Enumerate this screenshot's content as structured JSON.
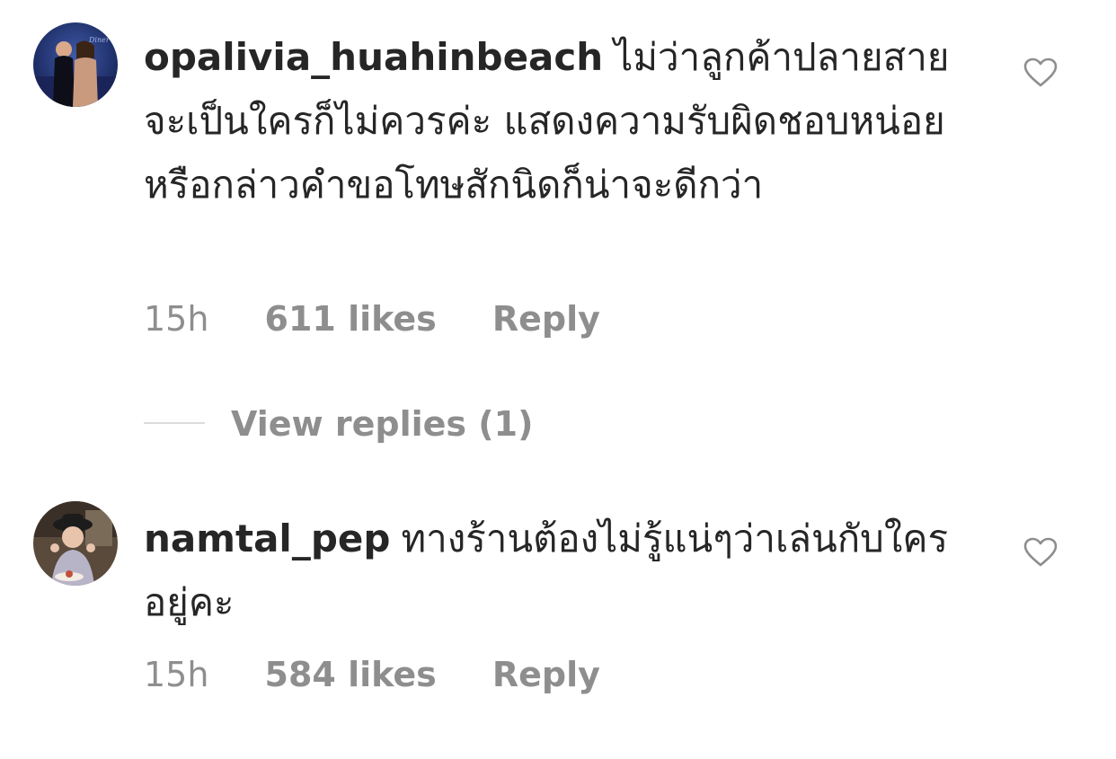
{
  "comments": [
    {
      "username": "opalivia_huahinbeach",
      "text": "ไม่ว่าลูกค้าปลายสายจะเป็นใครก็ไม่ควรค่ะ แสดงความรับผิดชอบหน่อย หรือกล่าวคำขอโทษสักนิดก็น่าจะดีกว่า",
      "time": "15h",
      "likes": "611 likes",
      "reply_label": "Reply",
      "avatar_icon": "avatar-photo",
      "like_icon": "heart-outline-icon",
      "view_replies_label": "View replies (1)"
    },
    {
      "username": "namtal_pep",
      "text": "ทางร้านต้องไม่รู้แน่ๆว่าเล่นกับใครอยู่คะ",
      "time": "15h",
      "likes": "584 likes",
      "reply_label": "Reply",
      "avatar_icon": "avatar-photo",
      "like_icon": "heart-outline-icon"
    }
  ],
  "colors": {
    "text": "#262626",
    "secondary": "#8e8e8e",
    "divider": "#dbdbdb"
  }
}
